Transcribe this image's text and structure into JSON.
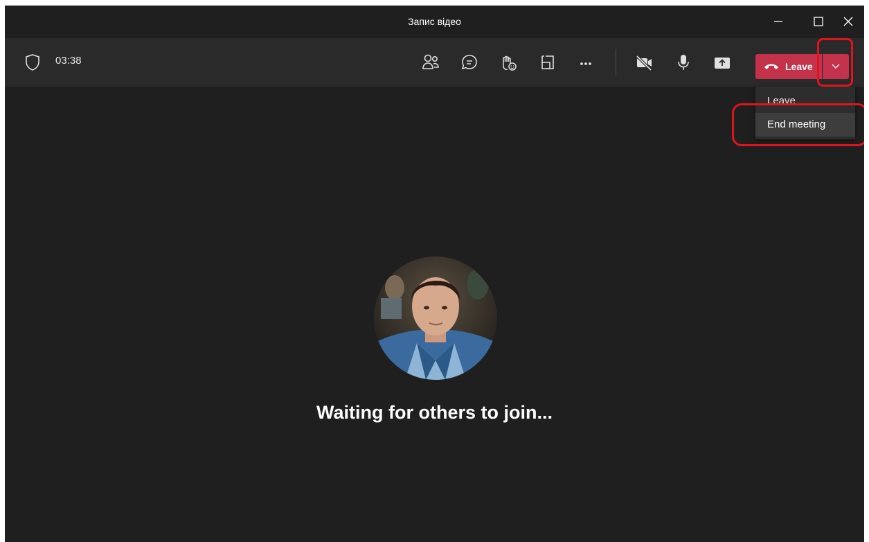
{
  "window": {
    "title": "Запис відео",
    "controls": [
      "minimize-icon",
      "maximize-icon",
      "close-icon"
    ]
  },
  "toolbar": {
    "shield_icon": "shield-icon",
    "timer": "03:38",
    "icons": [
      "people-icon",
      "chat-icon",
      "raise-hand-icon",
      "rooms-icon",
      "more-icon",
      "camera-off-icon",
      "microphone-icon",
      "share-icon"
    ],
    "leave_label": "Leave"
  },
  "leave_menu": {
    "items": [
      {
        "label": "Leave",
        "highlighted": false
      },
      {
        "label": "End meeting",
        "highlighted": true
      }
    ]
  },
  "main": {
    "status_text": "Waiting for others to join..."
  },
  "colors": {
    "background": "#1f1f1f",
    "toolbar": "#2a2a2a",
    "leave_accent": "#c4314b",
    "annotation": "#e0141e"
  }
}
